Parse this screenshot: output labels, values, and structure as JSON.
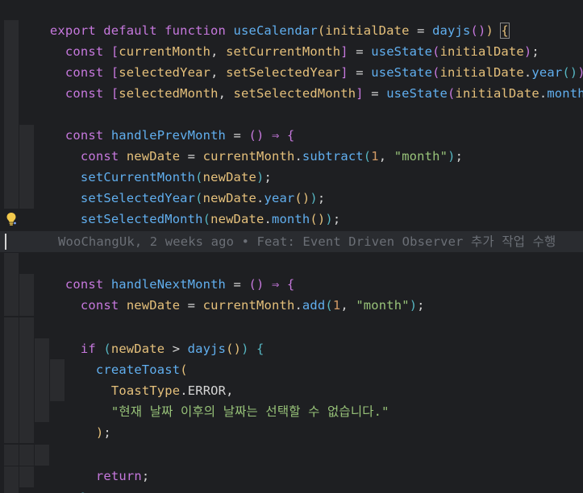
{
  "editor": {
    "function_signature": {
      "export_kw": "export",
      "default_kw": "default",
      "function_kw": "function",
      "name": "useCalendar",
      "param": "initialDate",
      "default_call": "dayjs"
    },
    "state_decls": [
      {
        "kw": "const",
        "getter": "currentMonth",
        "setter": "setCurrentMonth",
        "hook": "useState",
        "arg": "initialDate",
        "method": ""
      },
      {
        "kw": "const",
        "getter": "selectedYear",
        "setter": "setSelectedYear",
        "hook": "useState",
        "arg": "initialDate",
        "method": "year"
      },
      {
        "kw": "const",
        "getter": "selectedMonth",
        "setter": "setSelectedMonth",
        "hook": "useState",
        "arg": "initialDate",
        "method": "month"
      }
    ],
    "handle_prev": {
      "kw": "const",
      "name": "handlePrevMonth",
      "new_date_kw": "const",
      "new_date": "newDate",
      "source": "currentMonth",
      "op": "subtract",
      "amount": "1",
      "unit": "\"month\"",
      "calls": [
        {
          "fn": "setCurrentMonth",
          "arg": "newDate",
          "method": ""
        },
        {
          "fn": "setSelectedYear",
          "arg": "newDate",
          "method": "year"
        },
        {
          "fn": "setSelectedMonth",
          "arg": "newDate",
          "method": "month"
        }
      ]
    },
    "blame": "WooChangUk, 2 weeks ago • Feat: Event Driven Observer 추가 작업 수행",
    "handle_next": {
      "kw": "const",
      "name": "handleNextMonth",
      "new_date_kw": "const",
      "new_date": "newDate",
      "source": "currentMonth",
      "op": "add",
      "amount": "1",
      "unit": "\"month\"",
      "if_kw": "if",
      "cond_left": "newDate",
      "cond_fn": "dayjs",
      "toast_fn": "createToast",
      "toast_type_enum": "ToastType",
      "toast_type_value": "ERROR",
      "toast_message": "\"현재 날짜 이후의 날짜는 선택할 수 없습니다.\"",
      "return_kw": "return"
    }
  }
}
